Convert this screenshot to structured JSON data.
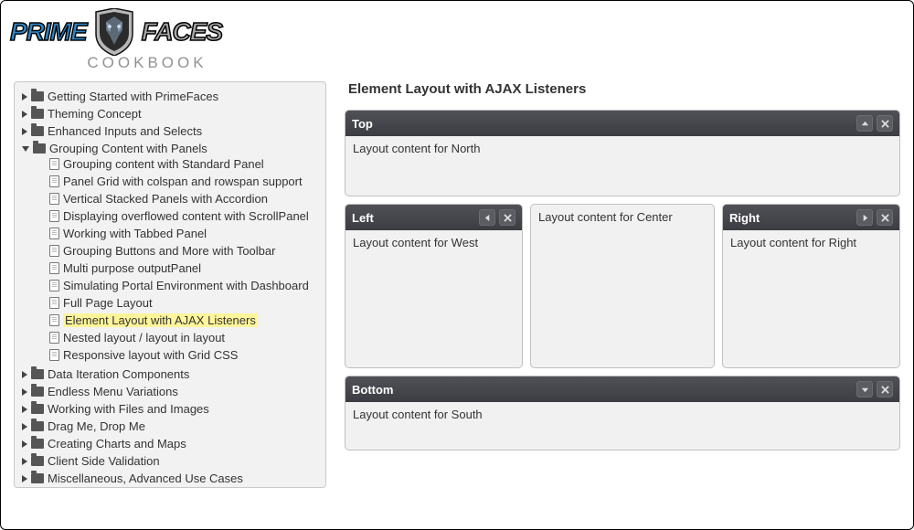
{
  "brand": {
    "prime": "PRIME",
    "faces": "FACES",
    "cookbook": "COOKBOOK"
  },
  "page_title": "Element Layout with AJAX Listeners",
  "tree": {
    "folders_top": [
      "Getting Started with PrimeFaces",
      "Theming Concept",
      "Enhanced Inputs and Selects"
    ],
    "expanded": {
      "label": "Grouping Content with Panels",
      "items": [
        "Grouping content with Standard Panel",
        "Panel Grid with colspan and rowspan support",
        "Vertical Stacked Panels with Accordion",
        "Displaying overflowed content with ScrollPanel",
        "Working with Tabbed Panel",
        "Grouping Buttons and More with Toolbar",
        "Multi purpose outputPanel",
        "Simulating Portal Environment with Dashboard",
        "Full Page Layout",
        "Element Layout with AJAX Listeners",
        "Nested layout / layout in layout",
        "Responsive layout with Grid CSS"
      ],
      "selected_index": 9
    },
    "folders_bottom": [
      "Data Iteration Components",
      "Endless Menu Variations",
      "Working with Files and Images",
      "Drag Me, Drop Me",
      "Creating Charts and Maps",
      "Client Side Validation",
      "Miscellaneous, Advanced Use Cases"
    ]
  },
  "layout": {
    "north": {
      "title": "Top",
      "content": "Layout content for North"
    },
    "west": {
      "title": "Left",
      "content": "Layout content for West"
    },
    "center": {
      "content": "Layout content for Center"
    },
    "east": {
      "title": "Right",
      "content": "Layout content for Right"
    },
    "south": {
      "title": "Bottom",
      "content": "Layout content for South"
    }
  }
}
